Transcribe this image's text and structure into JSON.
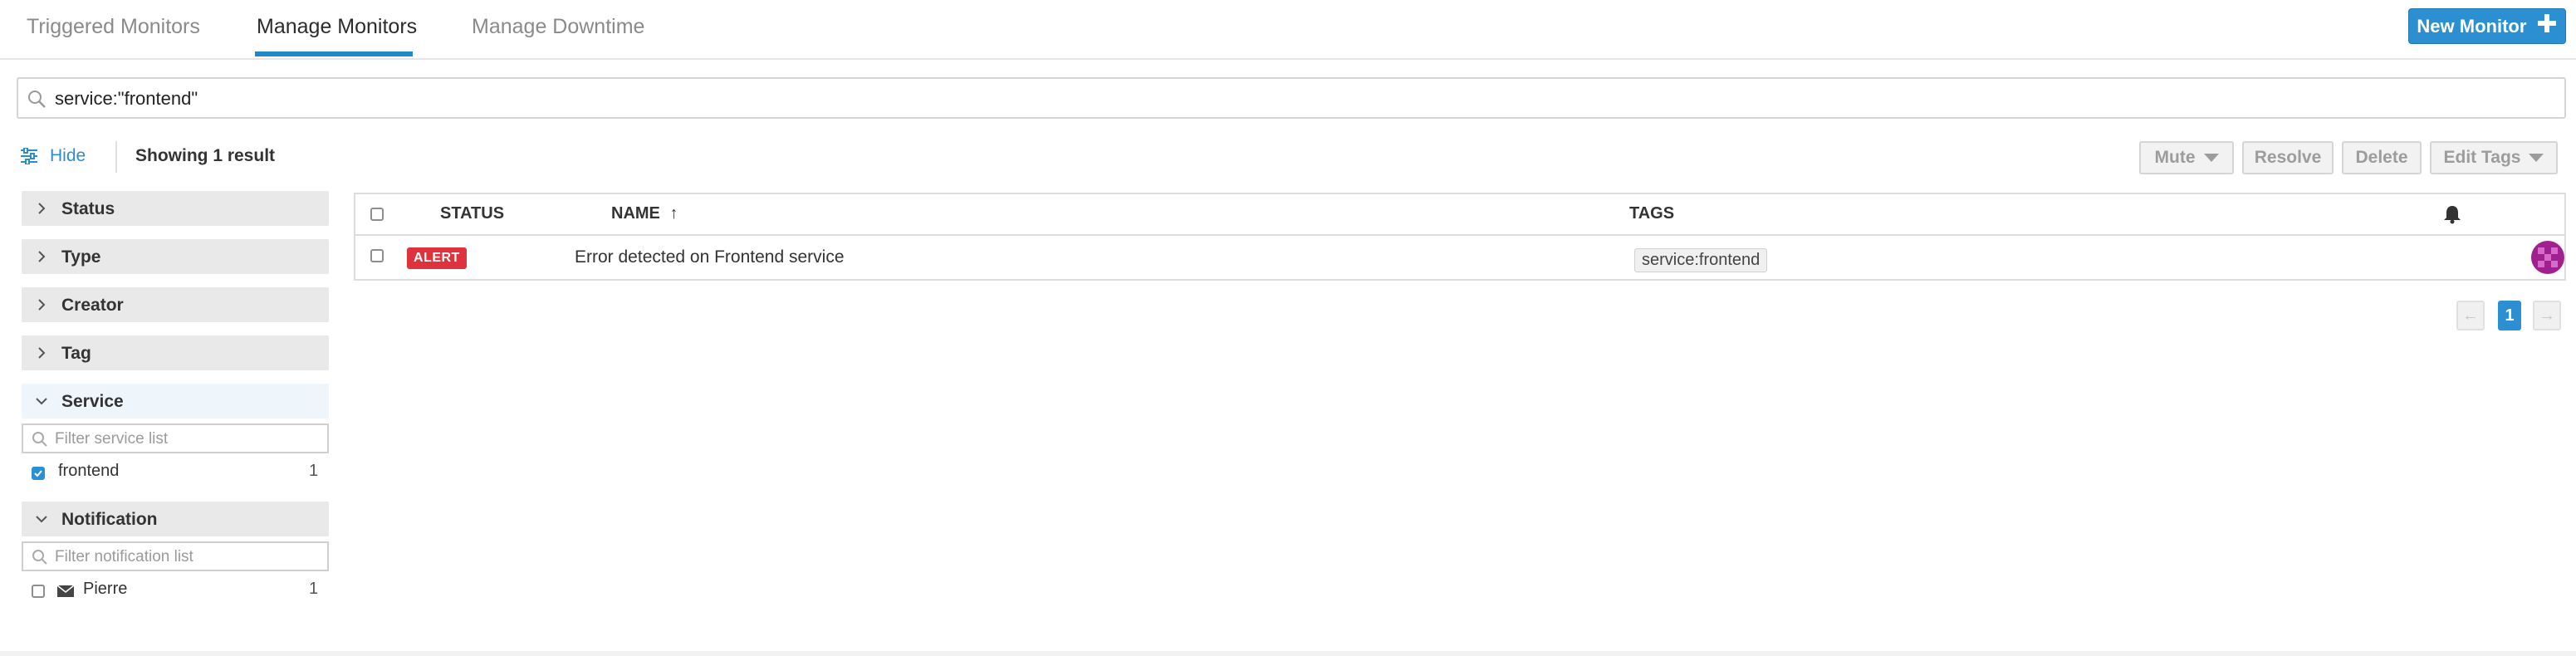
{
  "nav": {
    "tabs": [
      {
        "label": "Triggered Monitors"
      },
      {
        "label": "Manage Monitors"
      },
      {
        "label": "Manage Downtime"
      }
    ],
    "new_monitor_label": "New Monitor"
  },
  "search": {
    "value": "service:\"frontend\""
  },
  "toolbar": {
    "hide_label": "Hide",
    "showing_label": "Showing 1 result",
    "mute_label": "Mute",
    "resolve_label": "Resolve",
    "delete_label": "Delete",
    "edit_tags_label": "Edit Tags"
  },
  "sidebar": {
    "facets": [
      {
        "label": "Status"
      },
      {
        "label": "Type"
      },
      {
        "label": "Creator"
      },
      {
        "label": "Tag"
      },
      {
        "label": "Service"
      },
      {
        "label": "Notification"
      }
    ],
    "service_filter_placeholder": "Filter service list",
    "service_options": [
      {
        "label": "frontend",
        "count": "1",
        "checked": true
      }
    ],
    "notification_filter_placeholder": "Filter notification list",
    "notification_options": [
      {
        "label": "Pierre",
        "count": "1",
        "checked": false
      }
    ]
  },
  "table": {
    "headers": {
      "status": "STATUS",
      "name": "NAME",
      "tags": "TAGS"
    },
    "rows": [
      {
        "status": "ALERT",
        "name": "Error detected on Frontend service",
        "tag": "service:frontend"
      }
    ]
  },
  "pagination": {
    "current_page": "1",
    "prev": "←",
    "next": "→"
  },
  "colors": {
    "accent": "#2c8fd1",
    "alert": "#e0323c"
  },
  "icons": [
    "search-icon",
    "sliders-icon",
    "chevron-right-icon",
    "chevron-down-icon",
    "bell-icon",
    "envelope-icon",
    "plus-icon",
    "sort-arrow-icon"
  ]
}
